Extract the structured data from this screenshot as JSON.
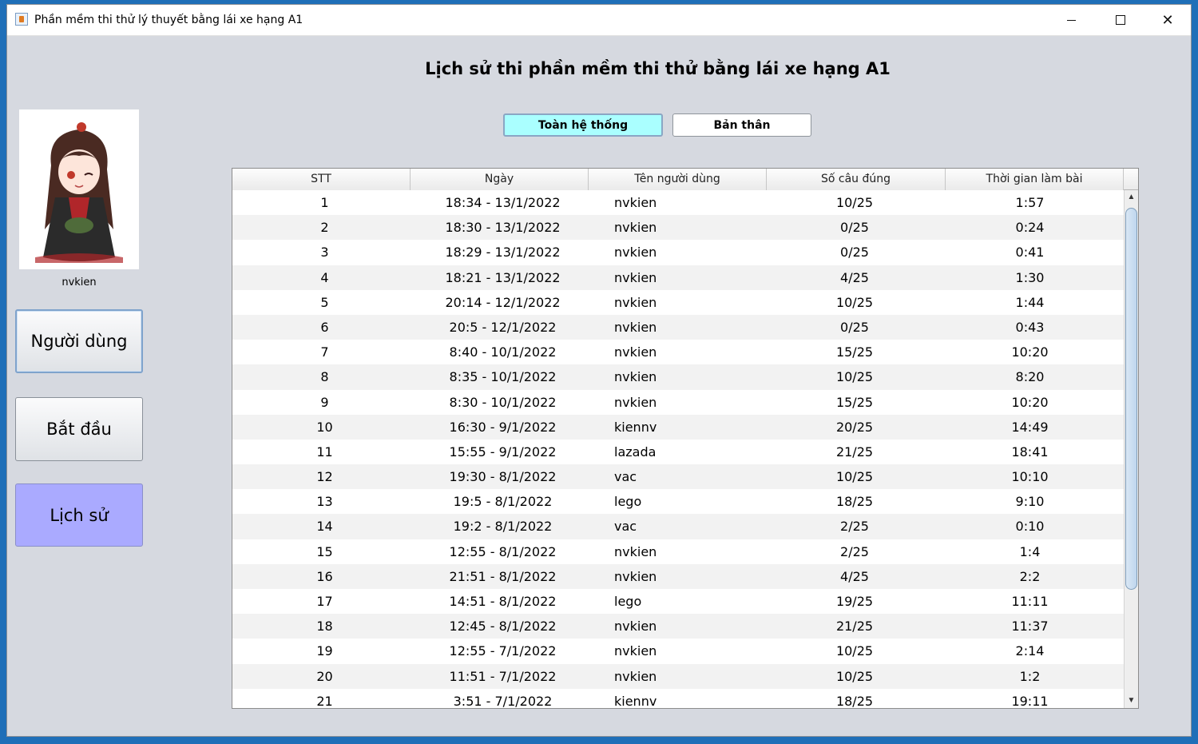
{
  "window": {
    "title": "Phần mềm thi thử lý thuyết bằng lái xe hạng A1",
    "controls": {
      "minimize": "—",
      "maximize": "☐",
      "close": "✕"
    }
  },
  "heading": "Lịch sử thi phần mềm thi thử bằng lái xe hạng A1",
  "sidebar": {
    "username": "nvkien",
    "buttons": [
      {
        "label": "Người dùng"
      },
      {
        "label": "Bắt đầu"
      },
      {
        "label": "Lịch sử"
      }
    ]
  },
  "tabs": {
    "system": "Toàn hệ thống",
    "self": "Bản thân"
  },
  "table": {
    "columns": [
      "STT",
      "Ngày",
      "Tên người dùng",
      "Số câu đúng",
      "Thời gian làm bài"
    ],
    "rows": [
      [
        "1",
        "18:34 - 13/1/2022",
        "nvkien",
        "10/25",
        "1:57"
      ],
      [
        "2",
        "18:30 - 13/1/2022",
        "nvkien",
        "0/25",
        "0:24"
      ],
      [
        "3",
        "18:29 - 13/1/2022",
        "nvkien",
        "0/25",
        "0:41"
      ],
      [
        "4",
        "18:21 - 13/1/2022",
        "nvkien",
        "4/25",
        "1:30"
      ],
      [
        "5",
        "20:14 - 12/1/2022",
        "nvkien",
        "10/25",
        "1:44"
      ],
      [
        "6",
        "20:5 - 12/1/2022",
        "nvkien",
        "0/25",
        "0:43"
      ],
      [
        "7",
        "8:40 - 10/1/2022",
        "nvkien",
        "15/25",
        "10:20"
      ],
      [
        "8",
        "8:35 - 10/1/2022",
        "nvkien",
        "10/25",
        "8:20"
      ],
      [
        "9",
        "8:30 - 10/1/2022",
        "nvkien",
        "15/25",
        "10:20"
      ],
      [
        "10",
        "16:30 - 9/1/2022",
        "kiennv",
        "20/25",
        "14:49"
      ],
      [
        "11",
        "15:55 - 9/1/2022",
        "lazada",
        "21/25",
        "18:41"
      ],
      [
        "12",
        "19:30 - 8/1/2022",
        "vac",
        "10/25",
        "10:10"
      ],
      [
        "13",
        "19:5 - 8/1/2022",
        "lego",
        "18/25",
        "9:10"
      ],
      [
        "14",
        "19:2 - 8/1/2022",
        "vac",
        "2/25",
        "0:10"
      ],
      [
        "15",
        "12:55 - 8/1/2022",
        "nvkien",
        "2/25",
        "1:4"
      ],
      [
        "16",
        "21:51 - 8/1/2022",
        "nvkien",
        "4/25",
        "2:2"
      ],
      [
        "17",
        "14:51 - 8/1/2022",
        "lego",
        "19/25",
        "11:11"
      ],
      [
        "18",
        "12:45 - 8/1/2022",
        "nvkien",
        "21/25",
        "11:37"
      ],
      [
        "19",
        "12:55 - 7/1/2022",
        "nvkien",
        "10/25",
        "2:14"
      ],
      [
        "20",
        "11:51 - 7/1/2022",
        "nvkien",
        "10/25",
        "1:2"
      ],
      [
        "21",
        "3:51 - 7/1/2022",
        "kiennv",
        "18/25",
        "19:11"
      ]
    ]
  }
}
